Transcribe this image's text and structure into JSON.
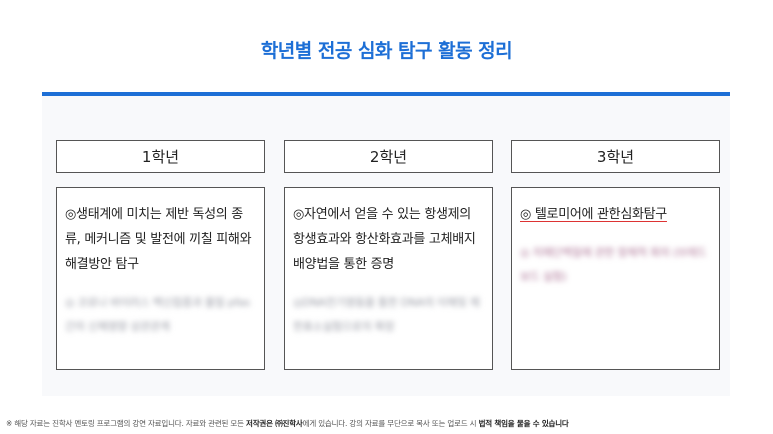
{
  "title": "학년별 전공 심화 탐구 활동 정리",
  "columns": [
    {
      "header": "1학년",
      "main_text": "◎생태계에 미치는 제반 독성의 종류, 메커니즘 및 발전에 끼칠 피해와 해결방안 탐구",
      "blurred_text": "◎ 코로나 바이러스 백신접종과 물질 pfas간의 신체영향 상관관계"
    },
    {
      "header": "2학년",
      "main_text": "◎자연에서 얻을 수 있는 항생제의 항생효과와 항산화효과를 고체배지 배양법을 통한 증명",
      "blurred_text": "◎DNA전기영동을 통한 DNA의 이해및 제한효소실험으로의 확장"
    },
    {
      "header": "3학년",
      "main_text": "◎ 텔로미어에 관한심화탐구",
      "blurred_text": "◎ 치매단백질에 관한 항체적 회의 (브레드보드 실험)"
    }
  ],
  "footer": {
    "prefix": "※ 해당 자료는 진학사 멘토링 프로그램의 강연 자료입니다. 자료와 관련된 모든 ",
    "bold1": "저작권은 ㈜진학사",
    "middle": "에게 있습니다. 강의 자료를 무단으로 복사 또는 업로드 시 ",
    "bold2": "법적 책임을 물을 수 있습니다"
  }
}
